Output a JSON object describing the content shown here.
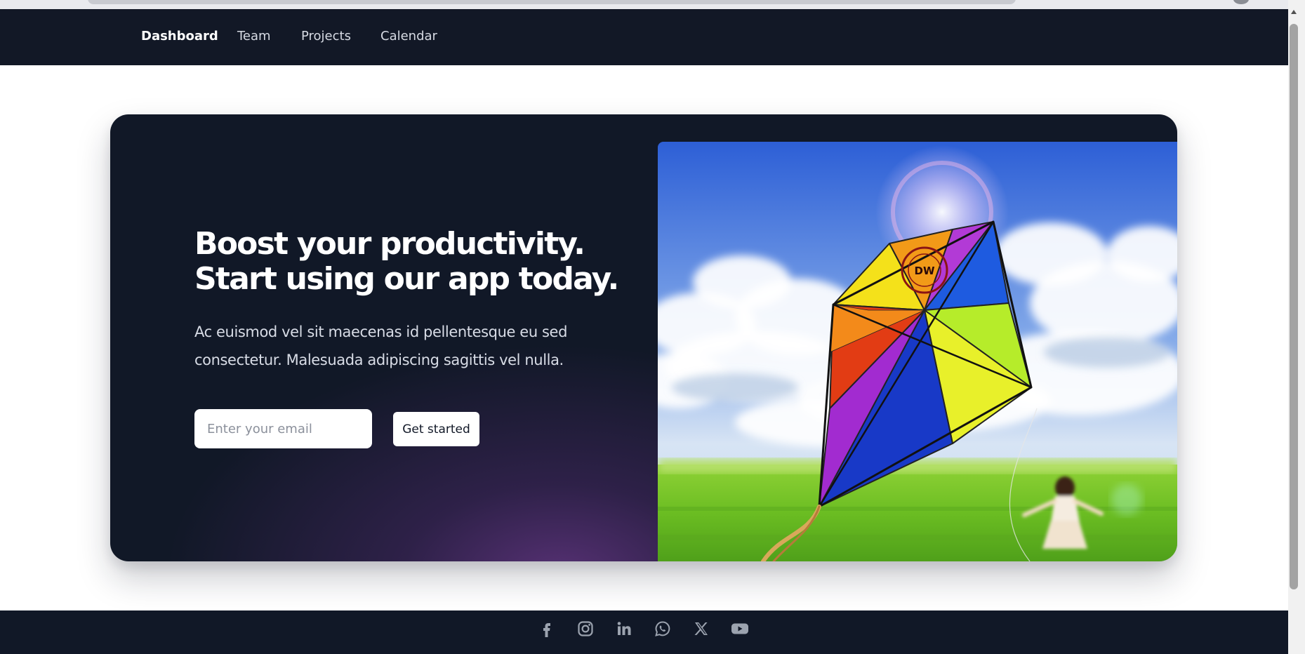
{
  "nav": {
    "items": [
      {
        "label": "Dashboard",
        "active": true
      },
      {
        "label": "Team",
        "active": false
      },
      {
        "label": "Projects",
        "active": false
      },
      {
        "label": "Calendar",
        "active": false
      }
    ]
  },
  "hero": {
    "title_line1": "Boost your productivity.",
    "title_line2": "Start using our app today.",
    "description": "Ac euismod vel sit maecenas id pellentesque eu sed consectetur. Malesuada adipiscing sagittis vel nulla.",
    "email_placeholder": "Enter your email",
    "cta_label": "Get started",
    "image_icon": "kite-photo",
    "kite_stamp_text": "DW"
  },
  "footer": {
    "social_icons": [
      "facebook-icon",
      "instagram-icon",
      "linkedin-icon",
      "whatsapp-icon",
      "x-icon",
      "youtube-icon"
    ]
  },
  "colors": {
    "nav_background": "#121826",
    "hero_background": "#111827",
    "hero_glow": "#5a3278",
    "footer_background": "#111827",
    "social_icon": "#9ca3af",
    "button_background": "#ffffff"
  }
}
